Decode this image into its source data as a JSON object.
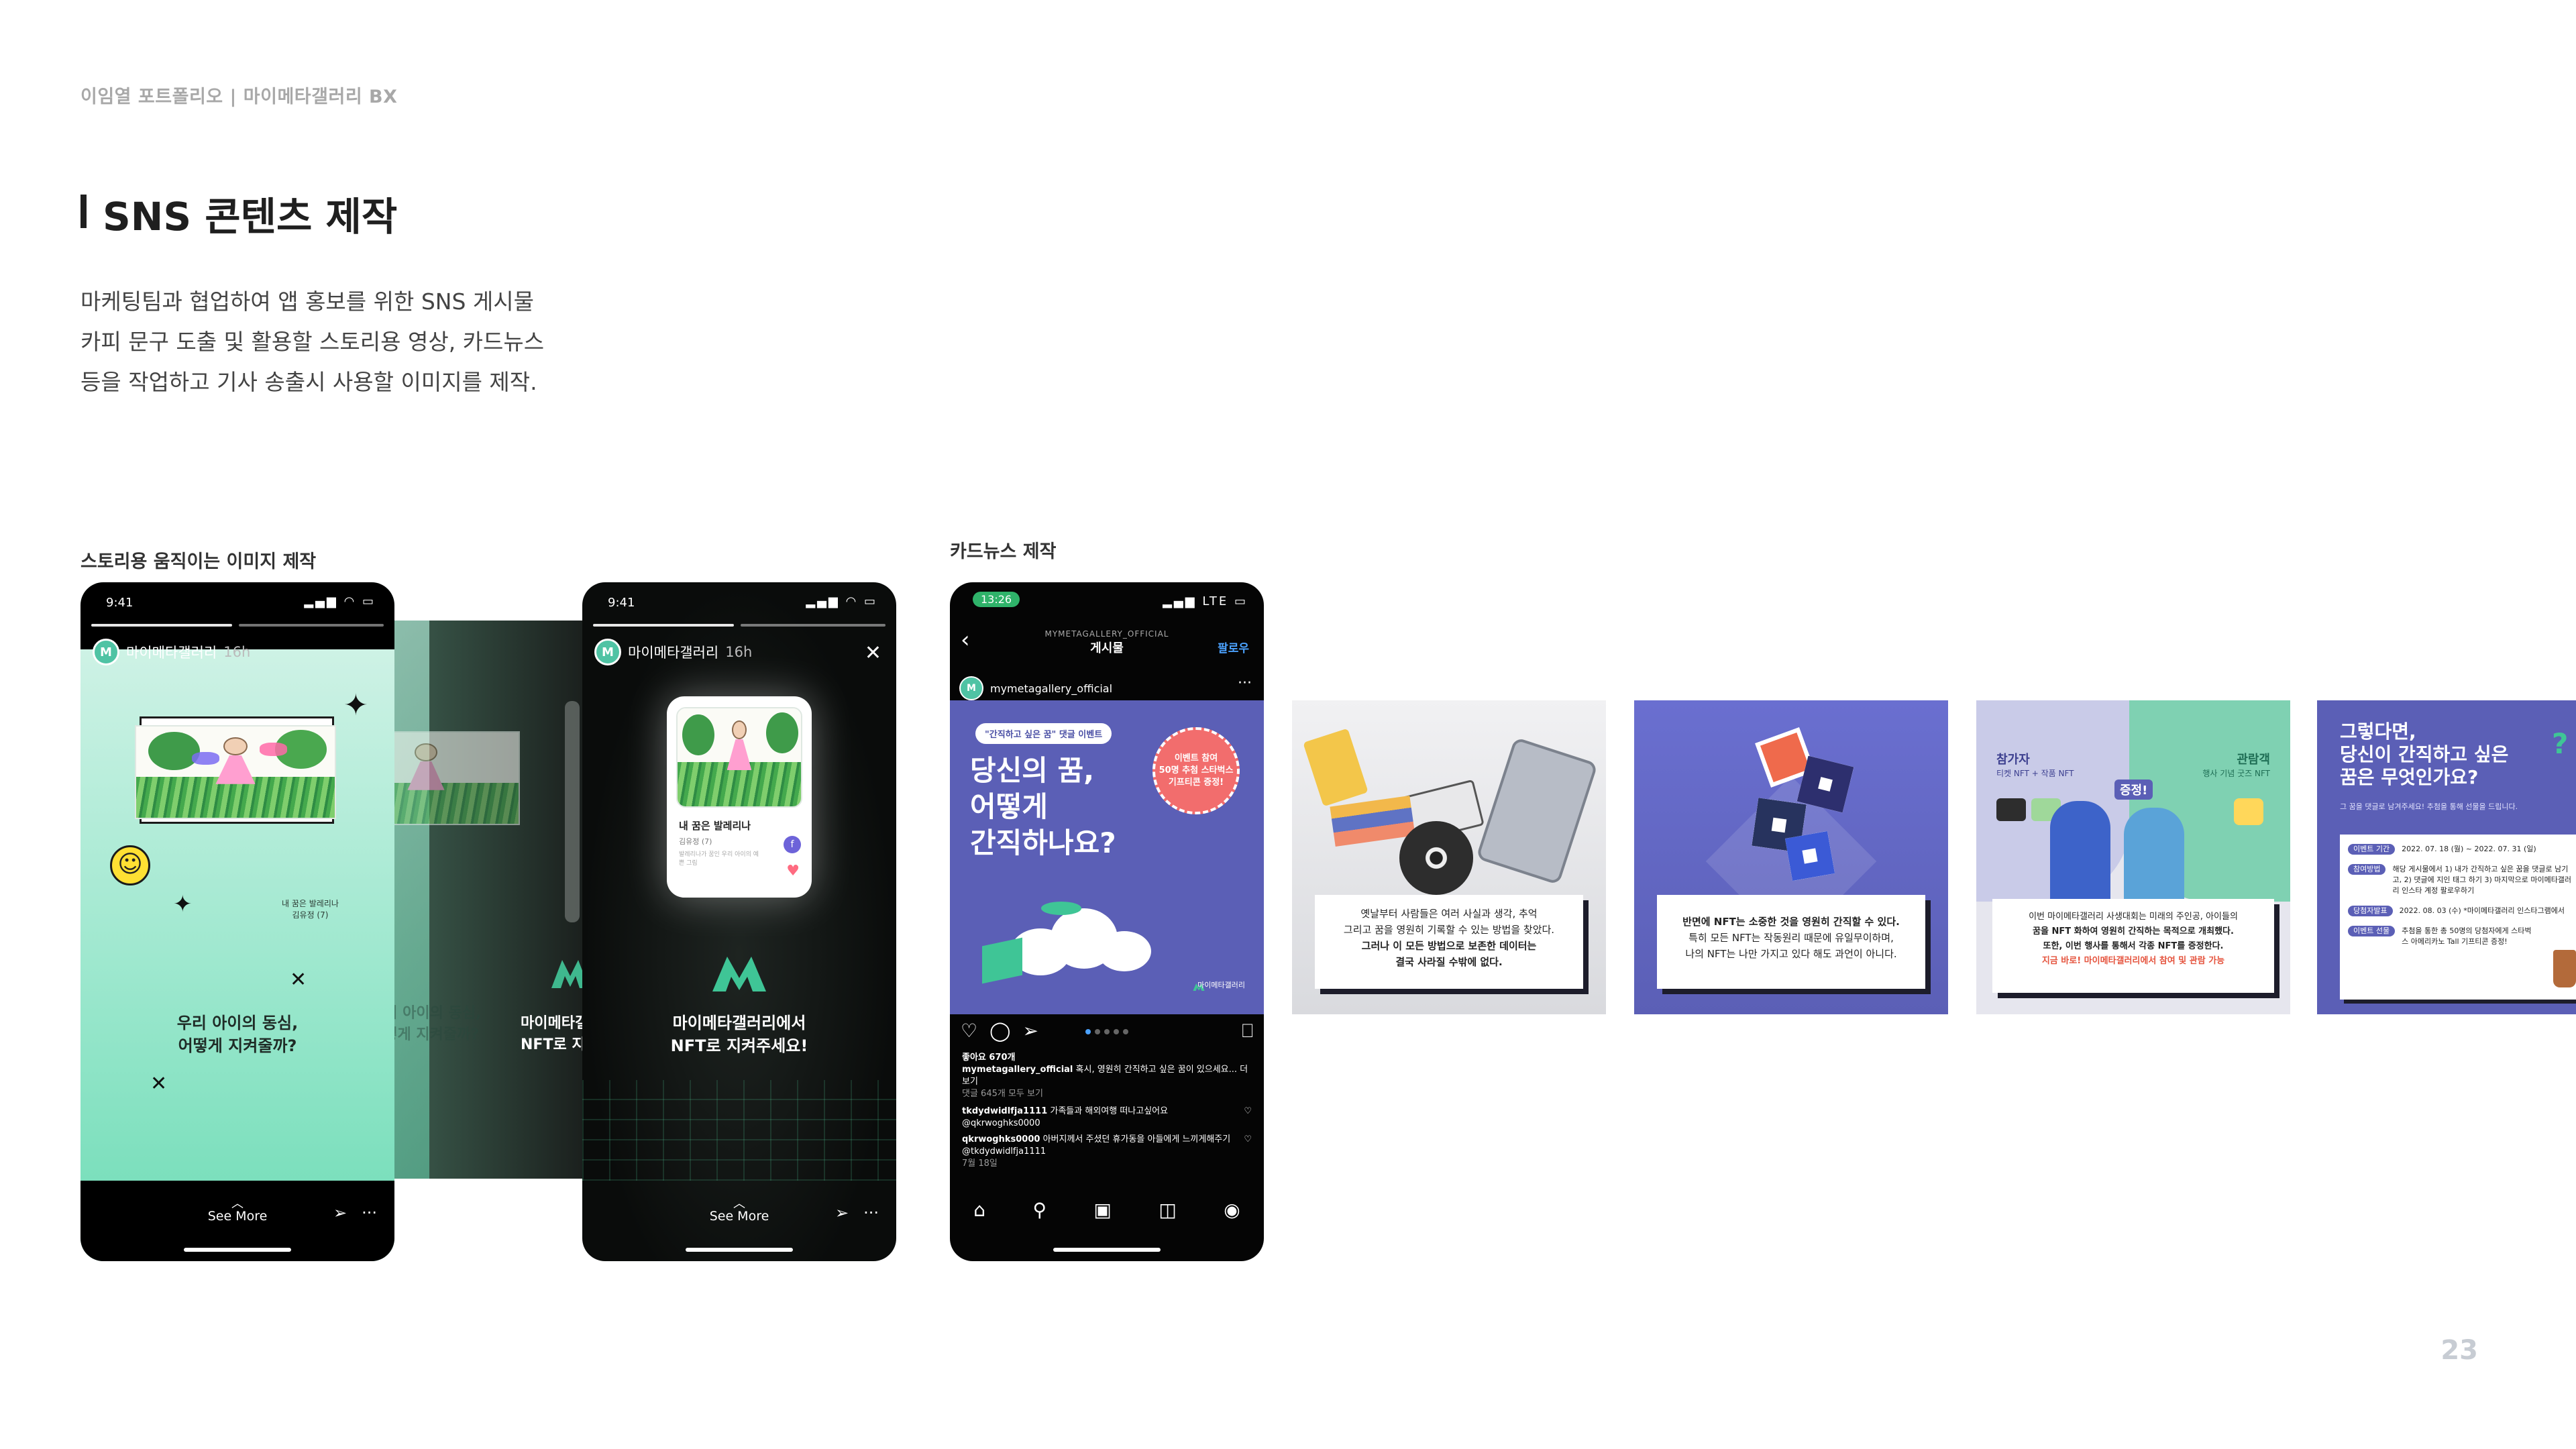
{
  "header": {
    "breadcrumb": "이임열 포트폴리오  |  마이메타갤러리 BX",
    "title": "SNS 콘텐츠 제작",
    "description_lines": [
      "마케팅팀과 협업하여 앱 홍보를 위한  SNS 게시물",
      "카피 문구 도출 및 활용할 스토리용 영상, 카드뉴스",
      "등을 작업하고 기사 송출시 사용할 이미지를 제작."
    ]
  },
  "sections": {
    "story_label": "스토리용 움직이는 이미지 제작",
    "cardnews_label": "카드뉴스 제작"
  },
  "story1": {
    "time": "9:41",
    "account": "마이메타갤러리",
    "ago": "16h",
    "drawing_title": "내 꿈은 발레리나",
    "drawing_author": "김유정 (7)",
    "headline_1": "우리 아이의 동심,",
    "headline_2": "어떻게 지켜줄까?",
    "faded_1": "우리 아이의 동심,",
    "faded_2": "어떻게 지켜줄까?",
    "right_1": "마이메타갤",
    "right_2": "NFT로 지",
    "see_more": "See More"
  },
  "story2": {
    "time": "9:41",
    "account": "마이메타갤러리",
    "ago": "16h",
    "card_title": "내 꿈은 발레리나",
    "card_author": "김유정 (7)",
    "card_desc": "발레리나가 꿈인 우리 아이의 예쁜 그림",
    "headline_1": "마이메타갤러리에서",
    "headline_2": "NFT로 지켜주세요!",
    "see_more": "See More"
  },
  "post": {
    "time": "13:26",
    "network": "LTE",
    "topbar_sub": "MYMETAGALLERY_OFFICIAL",
    "topbar_title": "게시물",
    "follow": "팔로우",
    "username": "mymetagallery_official",
    "pill": "\"간직하고 싶은 꿈\" 댓글 이벤트",
    "headline": [
      "당신의 꿈,",
      "어떻게",
      "간직하나요?"
    ],
    "badge": [
      "이벤트 참여",
      "50명 추첨 스타벅스",
      "기프티콘 증정!"
    ],
    "brand": "마이메타갤러리",
    "likes": "좋아요 670개",
    "caption_user": "mymetagallery_official",
    "caption": "혹시, 영원히 간직하고 싶은 꿈이 있으세요... 더 보기",
    "comments_link": "댓글 645개 모두 보기",
    "comment1_user": "tkdydwidlfja1111",
    "comment1": "가족들과 해외여행 떠나고싶어요",
    "comment1_tag": "@qkrwoghks0000",
    "comment2_user": "qkrwoghks0000",
    "comment2": "아버지께서 주셨던 휴가동을 아들에게 느끼게해주기",
    "comment2_tag": "@tkdydwidlfja1111",
    "date": "7월 18일"
  },
  "cards": {
    "card2": [
      "옛날부터 사람들은 여러 사실과 생각, 추억",
      "그리고 꿈을 영원히 기록할 수 있는 방법을 찾았다.",
      "그러나 이 모든 방법으로 보존한 데이터는",
      "결국 사라질 수밖에 없다."
    ],
    "card3": [
      "반면에 NFT는 소중한 것을 영원히 간직할 수 있다.",
      "특히 모든 NFT는 작동원리 때문에 유일무이하며,",
      "나의 NFT는 나만 가지고 있다 해도 과언이 아니다."
    ],
    "card4_left_title": "참가자",
    "card4_left_sub": "티켓 NFT + 작품 NFT",
    "card4_right_title": "관람객",
    "card4_right_sub": "행사 기념 굿즈 NFT",
    "card4_mid": "증정!",
    "card4_body": [
      "이번 마이메타갤러리 사생대회는 미래의 주인공, 아이들의",
      "꿈을 NFT 화하여 영원히 간직하는 목적으로 개최했다.",
      "또한, 이번 행사를 통해서 각종 NFT를 증정한다."
    ],
    "card4_cta": "지금 바로! 마이메타갤러리에서 참여 및 관람 가능",
    "card5_title": [
      "그렇다면,",
      "당신이 간직하고 싶은",
      "꿈은 무엇인가요?"
    ],
    "card5_sub": "그 꿈을 댓글로 남겨주세요! 추첨을 통해 선물을 드립니다.",
    "card5_rows": [
      {
        "label": "이벤트 기간",
        "value": "2022. 07. 18 (월) ~ 2022. 07. 31 (일)"
      },
      {
        "label": "참여방법",
        "value": "해당 게시물에서 1) 내가 간직하고 싶은 꿈을 댓글로 남기고, 2) 댓글에 지인 태그 하기 3) 마지막으로 마이메타갤러리 인스타 계정 팔로우하기"
      },
      {
        "label": "당첨자발표",
        "value": "2022. 08. 03 (수) *마이메타갤러리 인스타그램에서"
      },
      {
        "label": "이벤트 선물",
        "value": "추첨을 통한 총 50명의 당첨자에게 스타벅스 아메리카노 Tall 기프티콘 증정!"
      }
    ]
  },
  "page_number": "23",
  "colors": {
    "purple": "#5b5fb6",
    "mint": "#4fc3a4",
    "coral": "#f26d6d",
    "follow_blue": "#4ba2ff"
  }
}
